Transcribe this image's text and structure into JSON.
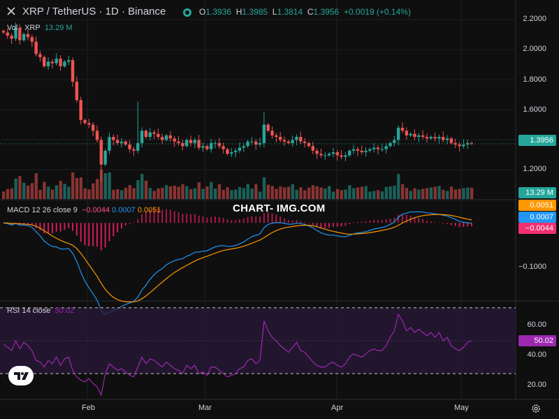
{
  "header": {
    "title": "XRP / TetherUS · 1D · Binance",
    "open_label": "O",
    "open": "1.3936",
    "high_label": "H",
    "high": "1.3985",
    "low_label": "L",
    "low": "1.3814",
    "close_label": "C",
    "close": "1.3956",
    "change": "+0.0019 (+0.14%)"
  },
  "volume_legend": {
    "label": "Vol · XRP",
    "value": "13.29 M"
  },
  "macd_legend": {
    "label": "MACD 12 26 close 9",
    "hist": "−0.0044",
    "macd": "0.0007",
    "signal": "0.0051"
  },
  "rsi_legend": {
    "label": "RSI 14 close",
    "value": "50.02"
  },
  "watermark": "CHART- IMG.COM",
  "badges": {
    "price": "1.3956",
    "volume": "13.29 M",
    "signal": "0.0051",
    "macd": "0.0007",
    "hist": "−0.0044",
    "rsi": "50.02"
  },
  "colors": {
    "up": "#26a69a",
    "down": "#ef5350",
    "macd": "#2196f3",
    "signal": "#ff9800",
    "hist_pos": "#e91e63",
    "rsi": "#9c27b0",
    "rsi_band": "#2a1a3a"
  },
  "icons": {
    "close": "close-icon",
    "status": "market-status-icon",
    "logo": "tradingview-logo-icon",
    "settings": "gear-icon"
  },
  "chart_data": [
    {
      "type": "candlestick",
      "title": "XRP / TetherUS · 1D · Binance",
      "x_ticks": [
        "Feb",
        "Mar",
        "Apr",
        "May"
      ],
      "y_ticks": [
        "2.2000",
        "2.0000",
        "1.8000",
        "1.6000",
        "1.4000",
        "1.2000"
      ],
      "ylim": [
        1.14,
        2.25
      ],
      "last_price": 1.3956,
      "close_series": [
        2.12,
        2.1,
        2.08,
        2.15,
        2.07,
        2.11,
        2.09,
        2.06,
        1.98,
        1.96,
        1.9,
        1.93,
        1.92,
        1.95,
        1.9,
        1.93,
        1.94,
        1.8,
        1.68,
        1.55,
        1.53,
        1.52,
        1.48,
        1.42,
        1.26,
        1.35,
        1.44,
        1.42,
        1.4,
        1.41,
        1.39,
        1.36,
        1.35,
        1.4,
        1.48,
        1.44,
        1.47,
        1.46,
        1.44,
        1.42,
        1.45,
        1.43,
        1.41,
        1.4,
        1.38,
        1.42,
        1.4,
        1.42,
        1.37,
        1.38,
        1.36,
        1.4,
        1.4,
        1.38,
        1.36,
        1.33,
        1.34,
        1.35,
        1.37,
        1.38,
        1.41,
        1.41,
        1.39,
        1.4,
        1.52,
        1.48,
        1.45,
        1.44,
        1.42,
        1.41,
        1.4,
        1.42,
        1.44,
        1.41,
        1.4,
        1.38,
        1.35,
        1.33,
        1.32,
        1.32,
        1.33,
        1.34,
        1.32,
        1.31,
        1.32,
        1.35,
        1.36,
        1.35,
        1.34,
        1.35,
        1.36,
        1.37,
        1.36,
        1.36,
        1.38,
        1.4,
        1.42,
        1.5,
        1.48,
        1.45,
        1.46,
        1.44,
        1.45,
        1.44,
        1.43,
        1.44,
        1.43,
        1.44,
        1.42,
        1.43,
        1.4,
        1.39,
        1.38,
        1.39,
        1.4,
        1.3956
      ],
      "volume_last": "13.29 M"
    },
    {
      "type": "line",
      "title": "MACD 12 26 close 9",
      "y_ticks": [
        "−0.1000"
      ],
      "series": [
        {
          "name": "MACD",
          "last": 0.0007
        },
        {
          "name": "Signal",
          "last": 0.0051
        },
        {
          "name": "Histogram",
          "last": -0.0044
        }
      ]
    },
    {
      "type": "line",
      "title": "RSI 14 close",
      "y_ticks": [
        "60.00",
        "40.00",
        "20.00"
      ],
      "ylim": [
        16,
        72
      ],
      "bands": [
        30,
        70
      ],
      "series": [
        {
          "name": "RSI",
          "values": [
            48,
            46,
            44,
            50,
            45,
            49,
            47,
            44,
            38,
            37,
            34,
            38,
            36,
            40,
            35,
            39,
            40,
            32,
            28,
            26,
            25,
            27,
            24,
            22,
            17,
            30,
            36,
            34,
            32,
            33,
            31,
            29,
            28,
            34,
            40,
            36,
            39,
            38,
            36,
            34,
            37,
            35,
            33,
            32,
            30,
            35,
            33,
            35,
            30,
            31,
            29,
            34,
            34,
            32,
            30,
            28,
            29,
            30,
            33,
            34,
            38,
            39,
            36,
            38,
            62,
            56,
            52,
            50,
            47,
            45,
            43,
            46,
            49,
            44,
            43,
            40,
            37,
            35,
            34,
            34,
            36,
            37,
            35,
            34,
            36,
            40,
            42,
            41,
            40,
            42,
            44,
            45,
            44,
            44,
            47,
            52,
            56,
            66,
            62,
            56,
            58,
            55,
            57,
            55,
            53,
            55,
            52,
            55,
            50,
            52,
            47,
            45,
            44,
            46,
            49,
            50.02
          ]
        }
      ]
    }
  ]
}
